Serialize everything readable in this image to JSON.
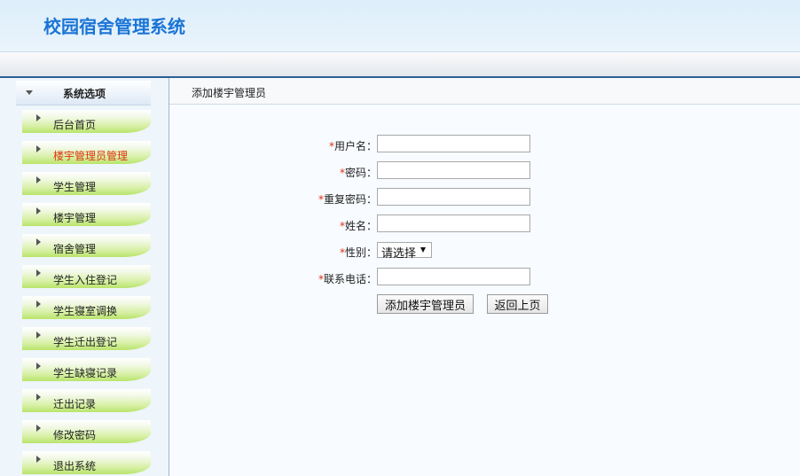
{
  "header": {
    "title": "校园宿舍管理系统"
  },
  "sidebar": {
    "title": "系统选项",
    "items": [
      {
        "label": "后台首页",
        "active": false
      },
      {
        "label": "楼宇管理员管理",
        "active": true
      },
      {
        "label": "学生管理",
        "active": false
      },
      {
        "label": "楼宇管理",
        "active": false
      },
      {
        "label": "宿舍管理",
        "active": false
      },
      {
        "label": "学生入住登记",
        "active": false
      },
      {
        "label": "学生寝室调换",
        "active": false
      },
      {
        "label": "学生迁出登记",
        "active": false
      },
      {
        "label": "学生缺寝记录",
        "active": false
      },
      {
        "label": "迁出记录",
        "active": false
      },
      {
        "label": "修改密码",
        "active": false
      },
      {
        "label": "退出系统",
        "active": false
      }
    ]
  },
  "content": {
    "title": "添加楼宇管理员",
    "form": {
      "required_mark": "*",
      "username_label": "用户名：",
      "password_label": "密码：",
      "confirm_label": "重复密码：",
      "name_label": "姓名：",
      "gender_label": "性别：",
      "gender_value": "请选择",
      "phone_label": "联系电话：",
      "username_value": "",
      "password_value": "",
      "confirm_value": "",
      "name_value": "",
      "phone_value": ""
    },
    "buttons": {
      "submit": "添加楼宇管理员",
      "back": "返回上页"
    }
  }
}
